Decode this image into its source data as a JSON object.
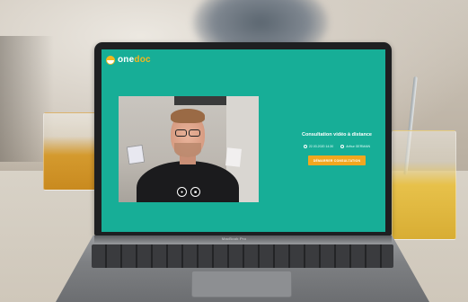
{
  "app": {
    "logo_prefix": "one",
    "logo_suffix": "doc",
    "brand_color": "#17ae97",
    "accent_color": "#f2a71f"
  },
  "consultation": {
    "title": "Consultation vidéo à distance",
    "datetime": "22.03.2020 14:30",
    "patient": "Arthur GERMAIN",
    "action_label": "DÉMARRER CONSULTATION"
  },
  "video": {
    "controls": [
      {
        "icon": "microphone-icon"
      },
      {
        "icon": "camera-icon"
      }
    ]
  },
  "device": {
    "label": "MacBook Pro"
  }
}
